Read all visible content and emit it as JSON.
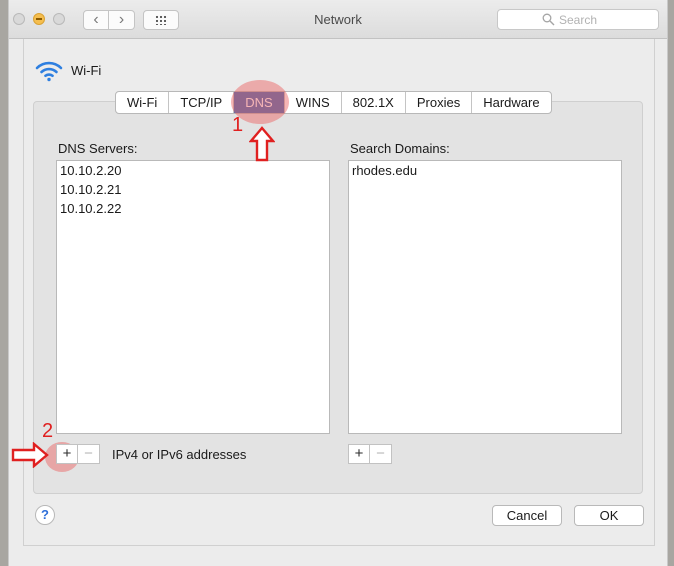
{
  "window": {
    "title": "Network"
  },
  "search": {
    "placeholder": "Search"
  },
  "interface": {
    "name": "Wi-Fi"
  },
  "tabs": [
    {
      "label": "Wi-Fi",
      "active": false
    },
    {
      "label": "TCP/IP",
      "active": false
    },
    {
      "label": "DNS",
      "active": true
    },
    {
      "label": "WINS",
      "active": false
    },
    {
      "label": "802.1X",
      "active": false
    },
    {
      "label": "Proxies",
      "active": false
    },
    {
      "label": "Hardware",
      "active": false
    }
  ],
  "dns": {
    "label": "DNS Servers:",
    "servers": [
      "10.10.2.20",
      "10.10.2.21",
      "10.10.2.22"
    ],
    "hint": "IPv4 or IPv6 addresses"
  },
  "search_domains": {
    "label": "Search Domains:",
    "domains": [
      "rhodes.edu"
    ]
  },
  "buttons": {
    "help": "?",
    "cancel": "Cancel",
    "ok": "OK",
    "add": "+",
    "remove": "−"
  },
  "annotations": {
    "step1": "1",
    "step2": "2"
  },
  "colors": {
    "tab_active": "#4a6fb5",
    "annotation": "#e02020",
    "wifi_icon": "#2e7fe0"
  }
}
